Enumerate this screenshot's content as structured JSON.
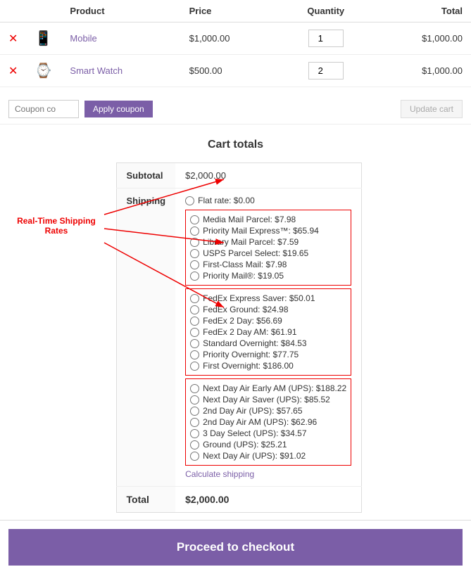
{
  "table": {
    "headers": [
      "",
      "",
      "Product",
      "Price",
      "Quantity",
      "Total"
    ],
    "rows": [
      {
        "product": "Mobile",
        "price": "$1,000.00",
        "qty": "1",
        "total": "$1,000.00",
        "icon": "📱"
      },
      {
        "product": "Smart Watch",
        "price": "$500.00",
        "qty": "2",
        "total": "$1,000.00",
        "icon": "⌚"
      }
    ]
  },
  "coupon": {
    "placeholder": "Coupon co",
    "apply_label": "Apply coupon",
    "update_label": "Update cart"
  },
  "cart_totals": {
    "title": "Cart totals",
    "subtotal_label": "Subtotal",
    "subtotal_value": "$2,000.00",
    "shipping_label": "Shipping",
    "flat_rate_label": "Flat rate: $0.00",
    "usps_options": [
      "Media Mail Parcel: $7.98",
      "Priority Mail Express™: $65.94",
      "Library Mail Parcel: $7.59",
      "USPS Parcel Select: $19.65",
      "First-Class Mail: $7.98",
      "Priority Mail®: $19.05"
    ],
    "fedex_options": [
      "FedEx Express Saver: $50.01",
      "FedEx Ground: $24.98",
      "FedEx 2 Day: $56.69",
      "FedEx 2 Day AM: $61.91",
      "Standard Overnight: $84.53",
      "Priority Overnight: $77.75",
      "First Overnight: $186.00"
    ],
    "ups_options": [
      "Next Day Air Early AM (UPS): $188.22",
      "Next Day Air Saver (UPS): $85.52",
      "2nd Day Air (UPS): $57.65",
      "2nd Day Air AM (UPS): $62.96",
      "3 Day Select (UPS): $34.57",
      "Ground (UPS): $25.21",
      "Next Day Air (UPS): $91.02"
    ],
    "calc_shipping_label": "Calculate shipping",
    "total_label": "Total",
    "total_value": "$2,000.00"
  },
  "annotation": {
    "label": "Real-Time Shipping Rates"
  },
  "checkout": {
    "button_label": "Proceed to checkout"
  }
}
